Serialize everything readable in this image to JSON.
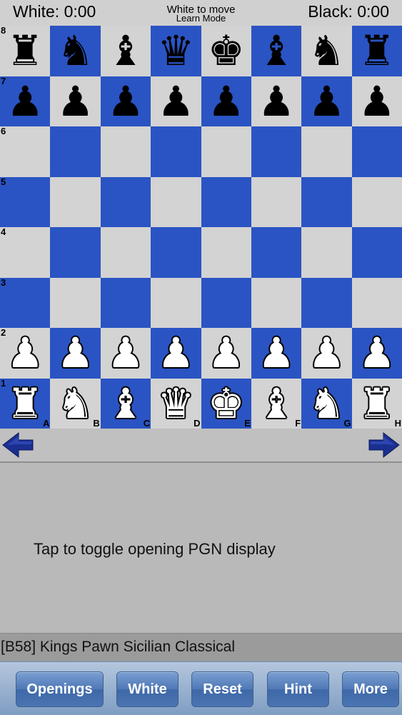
{
  "header": {
    "white_timer": "White: 0:00",
    "black_timer": "Black: 0:00",
    "status_line1": "White to move",
    "status_line2": "Learn Mode"
  },
  "board": {
    "colors": {
      "light": "#d3d3d3",
      "dark": "#2a54c3"
    },
    "rank_labels": [
      "8",
      "7",
      "6",
      "5",
      "4",
      "3",
      "2",
      "1"
    ],
    "file_labels": [
      "A",
      "B",
      "C",
      "D",
      "E",
      "F",
      "G",
      "H"
    ],
    "position": [
      [
        "br",
        "bn",
        "bb",
        "bq",
        "bk",
        "bb",
        "bn",
        "br"
      ],
      [
        "bp",
        "bp",
        "bp",
        "bp",
        "bp",
        "bp",
        "bp",
        "bp"
      ],
      [
        "",
        "",
        "",
        "",
        "",
        "",
        "",
        ""
      ],
      [
        "",
        "",
        "",
        "",
        "",
        "",
        "",
        ""
      ],
      [
        "",
        "",
        "",
        "",
        "",
        "",
        "",
        ""
      ],
      [
        "",
        "",
        "",
        "",
        "",
        "",
        "",
        ""
      ],
      [
        "wp",
        "wp",
        "wp",
        "wp",
        "wp",
        "wp",
        "wp",
        "wp"
      ],
      [
        "wr",
        "wn",
        "wb",
        "wq",
        "wk",
        "wb",
        "wn",
        "wr"
      ]
    ]
  },
  "navigation": {
    "back_icon": "arrow-left-icon",
    "forward_icon": "arrow-right-icon",
    "arrow_color": "#1a2f8f"
  },
  "pgn": {
    "toggle_text": "Tap to toggle opening PGN display"
  },
  "opening": {
    "name": "[B58] Kings Pawn Sicilian Classical"
  },
  "toolbar": {
    "openings_label": "Openings",
    "white_label": "White",
    "reset_label": "Reset",
    "hint_label": "Hint",
    "more_label": "More"
  }
}
